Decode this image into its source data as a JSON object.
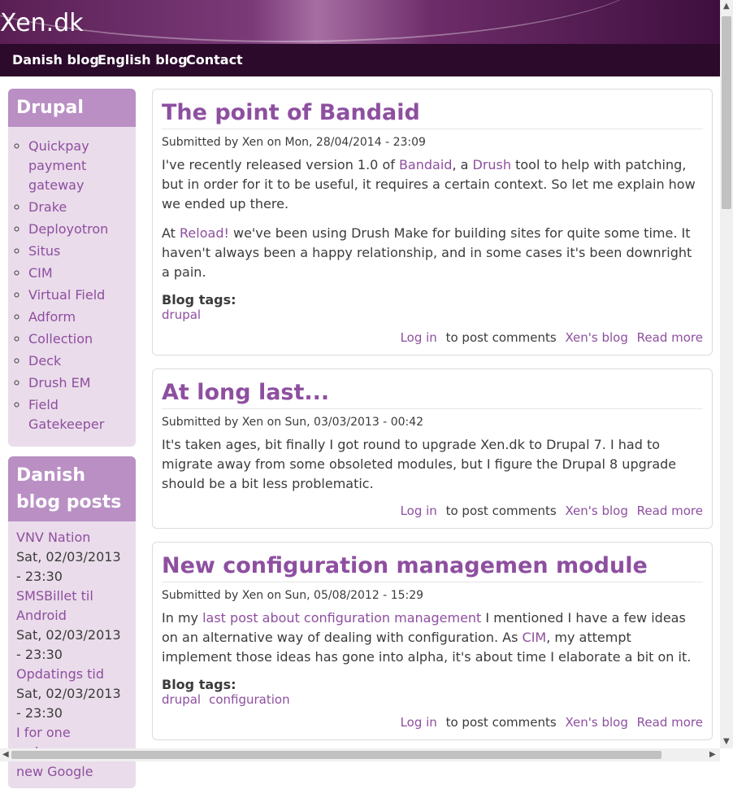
{
  "site": {
    "title": "Xen.dk"
  },
  "nav": [
    "Danish blog",
    "English blog",
    "Contact"
  ],
  "sidebar": {
    "drupal": {
      "title": "Drupal",
      "items": [
        "Quickpay payment gateway",
        "Drake",
        "Deployotron",
        "Situs",
        "CIM",
        "Virtual Field",
        "Adform",
        "Collection",
        "Deck",
        "Drush EM",
        "Field Gatekeeper"
      ]
    },
    "danish": {
      "title": "Danish blog posts",
      "posts": [
        {
          "title": "VNV Nation",
          "date": "Sat, 02/03/2013 - 23:30"
        },
        {
          "title": "SMSBillet til Android",
          "date": "Sat, 02/03/2013 - 23:30"
        },
        {
          "title": "Opdatings tid",
          "date": "Sat, 02/03/2013 - 23:30"
        },
        {
          "title": "I for one welcome our new Google",
          "date": ""
        }
      ]
    }
  },
  "posts": [
    {
      "title": "The point of Bandaid",
      "submitted": "Submitted by Xen on Mon, 28/04/2014 - 23:09",
      "p1a": "I've recently released version 1.0 of ",
      "p1l1": "Bandaid",
      "p1b": ", a ",
      "p1l2": "Drush",
      "p1c": " tool to help with patching, but in order for it to be useful, it requires a certain context. So let me explain how we ended up there.",
      "p2a": "At ",
      "p2l": "Reload!",
      "p2b": " we've been using Drush Make for building sites for quite some time. It haven't always been a happy relationship, and in some cases it's been downright a pain.",
      "tags_label": "Blog tags:",
      "tags": [
        "drupal"
      ]
    },
    {
      "title": "At long last...",
      "submitted": "Submitted by Xen on Sun, 03/03/2013 - 00:42",
      "p1": "It's taken ages, bit finally I got round to upgrade Xen.dk to Drupal 7. I had to migrate away from some obsoleted modules, but I figure the Drupal 8 upgrade should be a bit less problematic."
    },
    {
      "title": "New configuration managemen module",
      "submitted": "Submitted by Xen on Sun, 05/08/2012 - 15:29",
      "p1a": "In my ",
      "p1l1": "last post about configuration management",
      "p1b": " I mentioned I have a few ideas on an alternative way of dealing with configuration. As ",
      "p1l2": "CIM",
      "p1c": ", my attempt implement those ideas has gone into alpha, it's about time I elaborate a bit on it.",
      "tags_label": "Blog tags:",
      "tags": [
        "drupal",
        "configuration"
      ]
    }
  ],
  "links": {
    "login": "Log in",
    "to_post": "to post comments",
    "blog": "Xen's blog",
    "more": "Read more"
  }
}
